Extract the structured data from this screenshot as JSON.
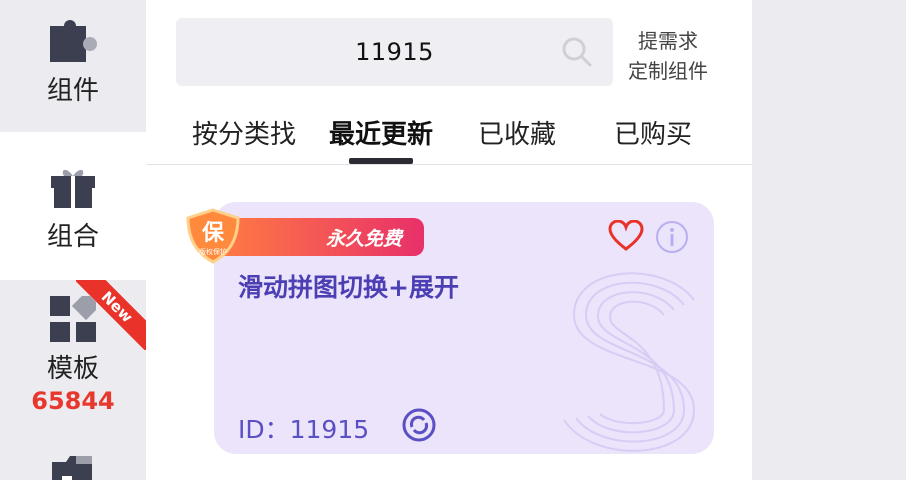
{
  "sidebar": {
    "items": [
      {
        "label": "组件",
        "icon": "puzzle-icon"
      },
      {
        "label": "组合",
        "icon": "gift-icon"
      },
      {
        "label": "模板",
        "icon": "grid-icon",
        "count": "65844",
        "ribbon": "New"
      },
      {
        "label": "",
        "icon": "folder-icon"
      }
    ]
  },
  "search": {
    "value": "11915"
  },
  "custom_request": {
    "line1": "提需求",
    "line2": "定制组件"
  },
  "tabs": [
    {
      "label": "按分类找"
    },
    {
      "label": "最近更新"
    },
    {
      "label": "已收藏"
    },
    {
      "label": "已购买"
    }
  ],
  "card": {
    "badge": "永久免费",
    "shield_char": "保",
    "shield_sub": "版权保护",
    "title": "滑动拼图切换+展开",
    "id_text": "ID：11915"
  },
  "colors": {
    "accent": "#4b3fb3",
    "count_red": "#e8382e",
    "card_bg": "#ebe4fb",
    "heart": "#e8322a"
  }
}
